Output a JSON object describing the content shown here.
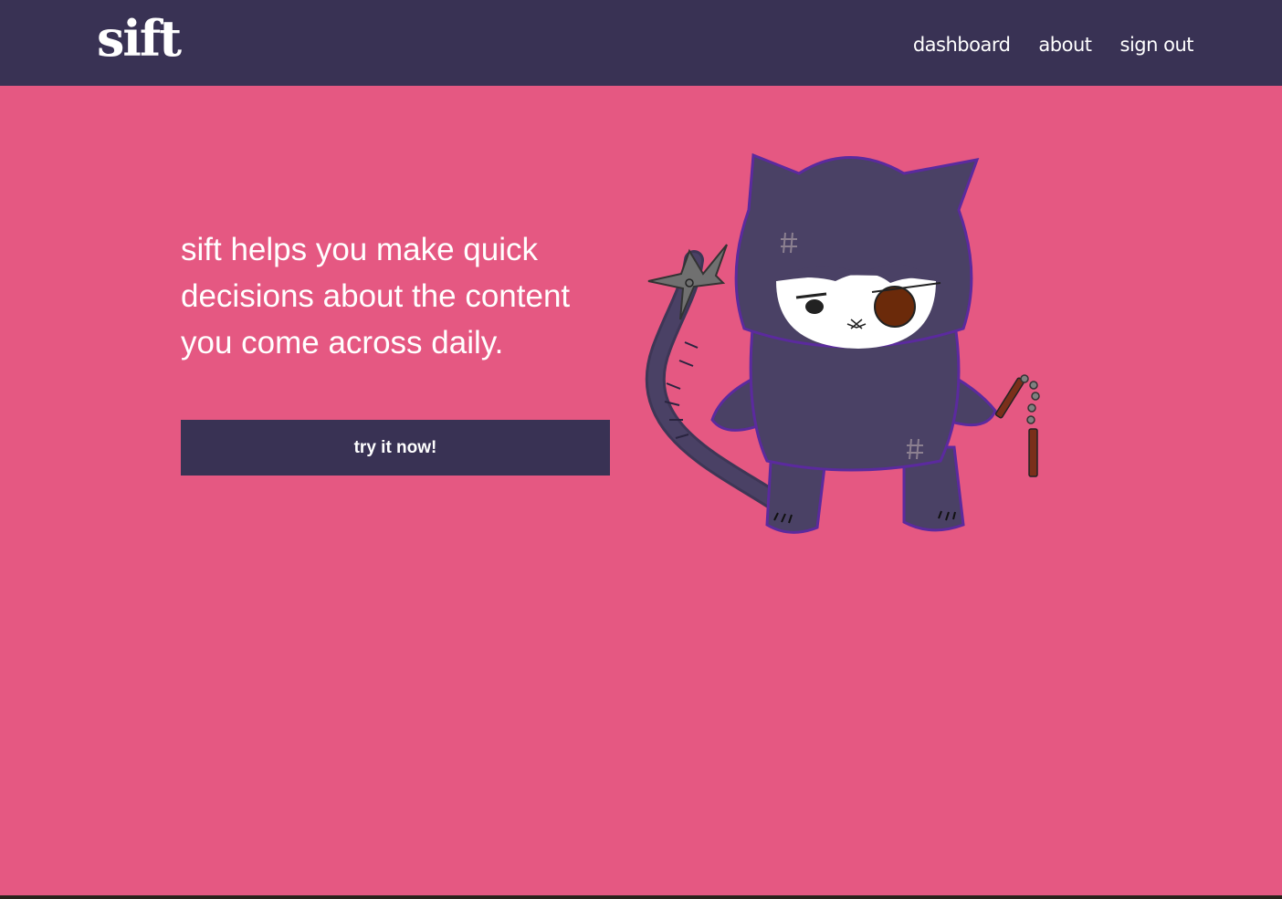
{
  "header": {
    "logo_text": "sift",
    "nav": {
      "dashboard": "dashboard",
      "about": "about",
      "sign_out": "sign out"
    }
  },
  "hero": {
    "tagline": "sift helps you make quick decisions about the content you come across daily.",
    "cta_label": "try it now!"
  },
  "colors": {
    "background": "#e55882",
    "navbar": "#393254",
    "button": "#393254",
    "text": "#ffffff",
    "mascot_body": "#4a4165"
  },
  "illustration": {
    "icon": "ninja-cat-mascot"
  }
}
